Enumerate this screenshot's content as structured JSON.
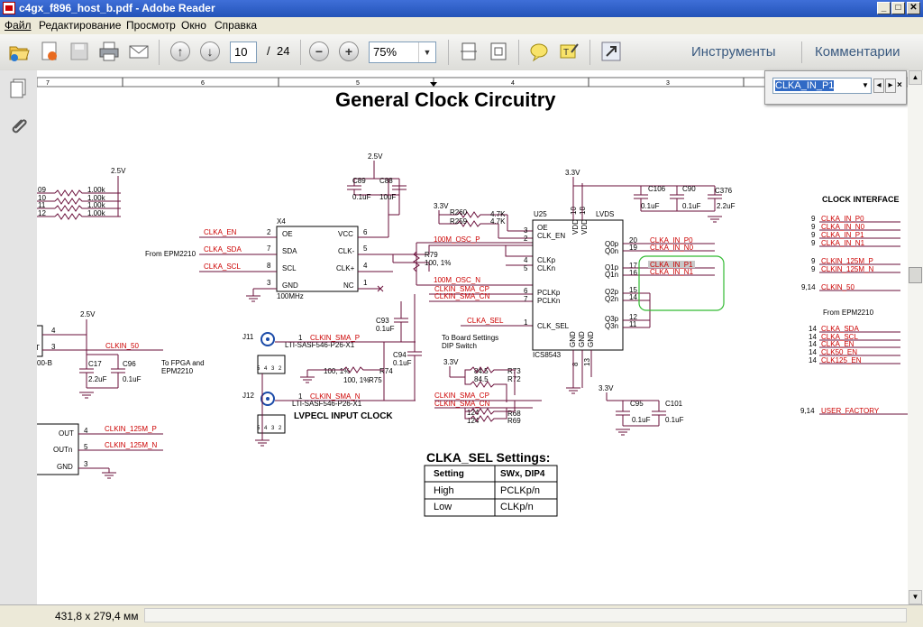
{
  "window": {
    "title": "c4gx_f896_host_b.pdf - Adobe Reader",
    "controls": {
      "minimize": "_",
      "maximize": "□",
      "close": "✕"
    }
  },
  "menu": [
    "Файл",
    "Редактирование",
    "Просмотр",
    "Окно",
    "Справка"
  ],
  "toolbar": {
    "page_current": "10",
    "page_sep": "/",
    "page_total": "24",
    "zoom": "75%",
    "tools_label": "Инструменты",
    "comments_label": "Комментарии"
  },
  "find": {
    "query": "CLKA_IN_P1"
  },
  "status": {
    "page_size": "431,8 x 279,4 мм"
  },
  "colors": {
    "accent": "#2353b8",
    "net": "#cc0000",
    "wire": "#6a0f3a",
    "highlight_box": "#33bb33"
  },
  "schematic": {
    "title": "General Clock Circuitry",
    "ruler": [
      "7",
      "6",
      "5",
      "4",
      "3"
    ],
    "left_top_labels": {
      "v25": "2.5V",
      "rows": [
        [
          "09",
          "1.00k"
        ],
        [
          "10",
          "1.00k"
        ],
        [
          "11",
          "1.00k"
        ],
        [
          "12",
          "1.00k"
        ]
      ],
      "from": "From EPM2210"
    },
    "x4": {
      "ref": "X4",
      "part": "100MHz",
      "pins_left": [
        "OE",
        "SDA",
        "SCL",
        "GND"
      ],
      "pins_left_num": [
        "2",
        "7",
        "8",
        "3"
      ],
      "pins_right": [
        "VCC",
        "CLK-",
        "CLK+",
        "NC"
      ],
      "pins_right_num": [
        "6",
        "5",
        "4",
        "1"
      ],
      "nets": [
        "CLKA_EN",
        "CLKA_SDA",
        "CLKA_SCL"
      ],
      "v": "2.5V"
    },
    "caps_top": [
      {
        "ref": "C89",
        "val": "0.1uF"
      },
      {
        "ref": "C88",
        "val": "10uF"
      }
    ],
    "resistors_mid": [
      {
        "ref": "R260",
        "val": "4.7K"
      },
      {
        "ref": "R259",
        "val": "4.7K"
      }
    ],
    "v33_a": "3.3V",
    "nets_mid": [
      "100M_OSC_P",
      "100M_OSC_N",
      "CLKIN_SMA_CP",
      "CLKIN_SMA_CN",
      "CLKA_SEL"
    ],
    "r79": {
      "ref": "R79",
      "val": "100, 1%"
    },
    "c93": {
      "ref": "C93",
      "val": "0.1uF"
    },
    "c94": {
      "ref": "C94",
      "val": "0.1uF"
    },
    "u25": {
      "ref": "U25",
      "title": "LVDS",
      "part": "ICS8543",
      "pins_left": [
        "OE",
        "CLK_EN",
        "CLKp",
        "CLKn",
        "PCLKp",
        "PCLKn",
        "CLK_SEL"
      ],
      "pins_left_num": [
        "3",
        "2",
        "4",
        "5",
        "6",
        "7",
        "1"
      ],
      "pins_right": [
        "Q0p",
        "Q0n",
        "Q1p",
        "Q1n",
        "Q2p",
        "Q2n",
        "Q3p",
        "Q3n"
      ],
      "pins_right_num": [
        "20",
        "19",
        "17",
        "16",
        "15",
        "14",
        "12",
        "11"
      ],
      "top_pins": [
        "VDD",
        "VDD"
      ],
      "top_nums": [
        "10",
        "18"
      ],
      "bottom_pins": [
        "GND",
        "GND",
        "GND"
      ],
      "bottom_nums": [
        "8",
        "13"
      ]
    },
    "outputs_right": [
      "CLKA_IN_P0",
      "CLKA_IN_N0",
      "CLKA_IN_P1",
      "CLKA_IN_N1"
    ],
    "caps_right_top": [
      {
        "ref": "C106",
        "val": "0.1uF"
      },
      {
        "ref": "C90",
        "val": "0.1uF"
      },
      {
        "ref": "C376",
        "val": "2.2uF"
      }
    ],
    "v33_b": "3.3V",
    "clock_interface": {
      "title": "CLOCK INTERFACE",
      "items": [
        [
          "9",
          "CLKA_IN_P0"
        ],
        [
          "9",
          "CLKA_IN_N0"
        ],
        [
          "9",
          "CLKA_IN_P1"
        ],
        [
          "9",
          "CLKA_IN_N1"
        ],
        [
          "9",
          "CLKIN_125M_P"
        ],
        [
          "9",
          "CLKIN_125M_N"
        ],
        [
          "9,14",
          "CLKIN_50"
        ]
      ],
      "from": "From EPM2210",
      "items2": [
        [
          "14",
          "CLKA_SDA"
        ],
        [
          "14",
          "CLKA_SCL"
        ],
        [
          "14",
          "CLKA_EN"
        ],
        [
          "14",
          "CLK50_EN"
        ],
        [
          "14",
          "CLK125_EN"
        ]
      ],
      "factory": [
        "9,14",
        "USER_FACTORY"
      ]
    },
    "left_mid": {
      "v25": "2.5V",
      "pin4": "4",
      "pin3": "3",
      "clkin50": "CLKIN_50",
      "t": "T",
      "partb": "00-B",
      "c17": {
        "ref": "C17",
        "val": "2.2uF"
      },
      "c96": {
        "ref": "C96",
        "val": "0.1uF"
      },
      "to_fpga": "To FPGA and",
      "epm": "EPM2210"
    },
    "left_bottom": {
      "pins": [
        "OUT",
        "OUTn",
        "GND"
      ],
      "nums": [
        "4",
        "5",
        "3"
      ],
      "nets": [
        "CLKIN_125M_P",
        "CLKIN_125M_N"
      ]
    },
    "j11": {
      "ref": "J11",
      "part": "LTI-SASF546-P26-X1",
      "net": "CLKIN_SMA_P",
      "pin": "1",
      "subpins": [
        "5",
        "4",
        "3",
        "2"
      ]
    },
    "j12": {
      "ref": "J12",
      "part": "LTI-SASF546-P26-X1",
      "net": "CLKIN_SMA_N",
      "pin": "1",
      "subpins": [
        "5",
        "4",
        "3",
        "2"
      ]
    },
    "r74": {
      "ref": "R74",
      "val": "100, 1%"
    },
    "r75": {
      "ref": "R75",
      "val": "100, 1%"
    },
    "lvpecl": "LVPECL INPUT CLOCK",
    "dip": {
      "line1": "To Board Settings",
      "line2": "DIP Switch"
    },
    "sel_res": {
      "v": "3.3V",
      "r73": {
        "ref": "R73",
        "val": "84.5"
      },
      "r72": {
        "ref": "R72",
        "val": "84.5"
      },
      "r68": {
        "ref": "R68",
        "val": "124"
      },
      "r69": {
        "ref": "R69",
        "val": "124"
      },
      "nets": [
        "CLKIN_SMA_CP",
        "CLKIN_SMA_CN"
      ]
    },
    "caps_bottom": {
      "v": "3.3V",
      "c95": {
        "ref": "C95",
        "val": "0.1uF"
      },
      "c101": {
        "ref": "C101",
        "val": "0.1uF"
      }
    },
    "settings": {
      "title": "CLKA_SEL Settings:",
      "headers": [
        "Setting",
        "SWx, DIP4"
      ],
      "rows": [
        [
          "High",
          "PCLKp/n"
        ],
        [
          "Low",
          "CLKp/n"
        ]
      ]
    }
  }
}
